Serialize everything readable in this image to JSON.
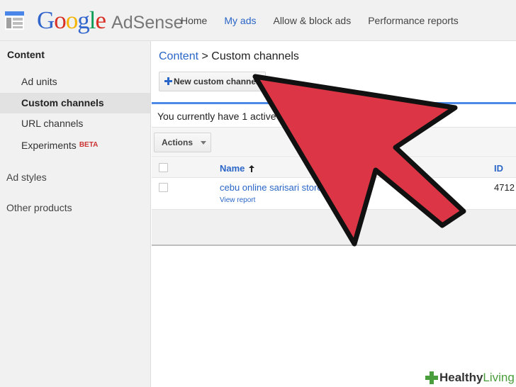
{
  "header": {
    "logo_google": [
      "G",
      "o",
      "o",
      "g",
      "l",
      "e"
    ],
    "logo_product": "AdSense",
    "nav": [
      {
        "label": "Home"
      },
      {
        "label": "My ads"
      },
      {
        "label": "Allow & block ads"
      },
      {
        "label": "Performance reports"
      }
    ]
  },
  "sidebar": {
    "section_title": "Content",
    "items": [
      {
        "label": "Ad units"
      },
      {
        "label": "Custom channels"
      },
      {
        "label": "URL channels"
      },
      {
        "label": "Experiments",
        "badge": "BETA"
      }
    ],
    "ad_styles": "Ad styles",
    "other_products": "Other products"
  },
  "main": {
    "breadcrumb_link": "Content",
    "breadcrumb_sep": " > ",
    "breadcrumb_current": "Custom channels",
    "new_button_label": "New custom channel",
    "info_text": "You currently have 1 active",
    "actions_label": "Actions",
    "table": {
      "col_name": "Name",
      "col_id": "ID",
      "rows": [
        {
          "name": "cebu online sarisari store",
          "link": "View report",
          "id": "4712"
        }
      ]
    }
  },
  "watermark": {
    "part1": "Healthy",
    "part2": "Living"
  },
  "colors": {
    "link_blue": "#2a66c7",
    "arrow_red": "#dc3545",
    "google_blue": "#3366cc",
    "google_red": "#d93025",
    "google_yellow": "#f4b400",
    "google_green": "#0f9d58"
  }
}
